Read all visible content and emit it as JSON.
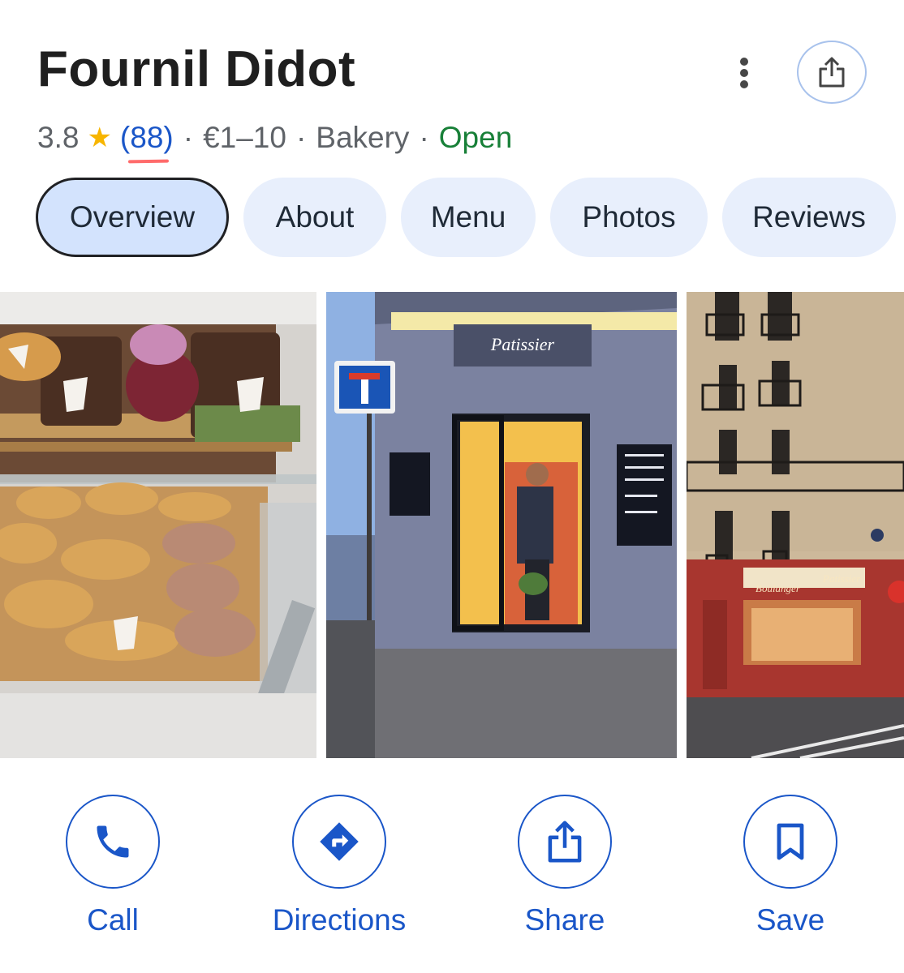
{
  "place": {
    "name": "Fournil Didot",
    "rating": "3.8",
    "review_count": "(88)",
    "price": "€1–10",
    "category": "Bakery",
    "status": "Open"
  },
  "header": {
    "more_icon": "more-vertical-icon",
    "share_icon": "share-icon"
  },
  "tabs": [
    {
      "label": "Overview",
      "active": true
    },
    {
      "label": "About"
    },
    {
      "label": "Menu"
    },
    {
      "label": "Photos"
    },
    {
      "label": "Reviews"
    }
  ],
  "photos": [
    {
      "subject": "pastry display case"
    },
    {
      "subject": "bakery entrance with Patissier sign"
    },
    {
      "subject": "bakery storefront on street corner"
    }
  ],
  "sign_text": {
    "patissier": "Patissier",
    "boulanger": "Boulanger"
  },
  "actions": [
    {
      "label": "Call",
      "icon": "phone-icon"
    },
    {
      "label": "Directions",
      "icon": "directions-icon"
    },
    {
      "label": "Share",
      "icon": "share-icon"
    },
    {
      "label": "Save",
      "icon": "bookmark-icon"
    }
  ],
  "colors": {
    "accent": "#1a56c8",
    "open": "#188038",
    "star": "#f7b500",
    "tab_bg": "#e8effc",
    "tab_active_bg": "#d3e3fd"
  }
}
